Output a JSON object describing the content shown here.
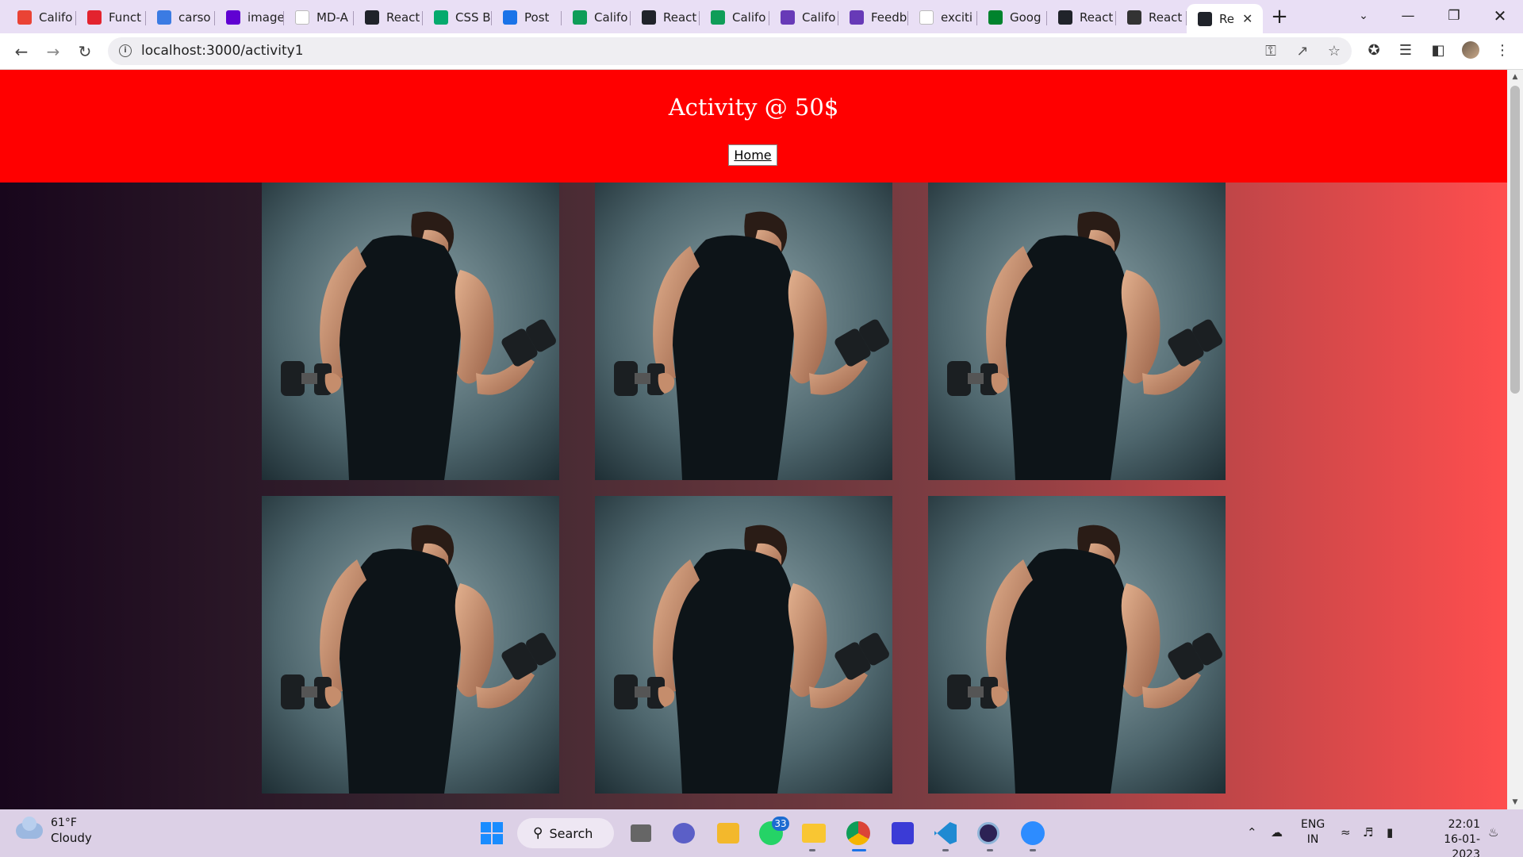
{
  "browser": {
    "tabs": [
      {
        "label": "Califo",
        "icon": "gmail-icon",
        "color": "#ea4335"
      },
      {
        "label": "Funct",
        "icon": "shield-icon",
        "color": "#e3232e"
      },
      {
        "label": "carso",
        "icon": "bolt-icon",
        "color": "#3b7be3"
      },
      {
        "label": "image",
        "icon": "yahoo-icon",
        "color": "#6001d2"
      },
      {
        "label": "MD-A",
        "icon": "github-icon",
        "color": "#ffffff"
      },
      {
        "label": "React",
        "icon": "react-icon",
        "color": "#20232a"
      },
      {
        "label": "CSS B",
        "icon": "w3schools-icon",
        "color": "#04aa6d"
      },
      {
        "label": "Post",
        "icon": "zeplin-icon",
        "color": "#1a73e8"
      },
      {
        "label": "Califo",
        "icon": "sheets-icon",
        "color": "#0f9d58"
      },
      {
        "label": "React",
        "icon": "react-icon",
        "color": "#20232a"
      },
      {
        "label": "Califo",
        "icon": "sheets-icon",
        "color": "#0f9d58"
      },
      {
        "label": "Califo",
        "icon": "forms-icon",
        "color": "#673ab7"
      },
      {
        "label": "Feedb",
        "icon": "forms-icon",
        "color": "#673ab7"
      },
      {
        "label": "exciti",
        "icon": "blank-page-icon",
        "color": "#ffffff"
      },
      {
        "label": "Goog",
        "icon": "meet-icon",
        "color": "#00832d"
      },
      {
        "label": "React",
        "icon": "react-icon",
        "color": "#20232a"
      },
      {
        "label": "React",
        "icon": "globe-icon",
        "color": "#333333"
      },
      {
        "label": "Re",
        "icon": "react-icon",
        "color": "#20232a",
        "active": true
      }
    ],
    "url": "localhost:3000/activity1"
  },
  "page": {
    "title": "Activity @ 50$",
    "home_button": "Home",
    "header_color": "#ff0000",
    "cards": [
      {
        "image": "man-lifting-dumbbell-photo"
      },
      {
        "image": "man-lifting-dumbbell-photo"
      },
      {
        "image": "man-lifting-dumbbell-photo"
      },
      {
        "image": "man-lifting-dumbbell-photo"
      },
      {
        "image": "man-lifting-dumbbell-photo"
      },
      {
        "image": "man-lifting-dumbbell-photo"
      }
    ]
  },
  "taskbar": {
    "weather_temp": "61°F",
    "weather_desc": "Cloudy",
    "search_label": "Search",
    "whatsapp_badge": "33",
    "lang_top": "ENG",
    "lang_bottom": "IN",
    "time": "22:01",
    "date": "16-01-2023"
  }
}
